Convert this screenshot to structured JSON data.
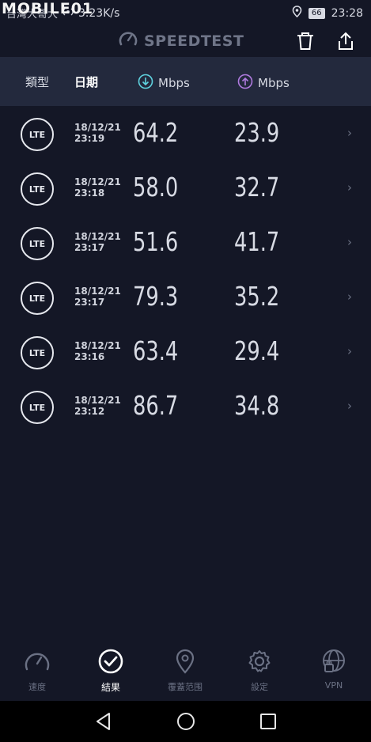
{
  "status_bar": {
    "carrier": "台灣大哥大",
    "watermark": "MOBILE01",
    "net_speed": "3.23K/s",
    "battery": "66",
    "time": "23:28"
  },
  "top_bar": {
    "title": "SPEEDTEST",
    "icons": [
      "speedometer-icon",
      "trash-icon",
      "share-icon"
    ]
  },
  "table_header": {
    "type_label": "類型",
    "date_label": "日期",
    "download_label": "Mbps",
    "upload_label": "Mbps",
    "download_icon_color": "#5fd3e0",
    "upload_icon_color": "#b07be0"
  },
  "results": [
    {
      "type": "LTE",
      "date": "18/12/21",
      "time": "23:19",
      "download": "64.2",
      "upload": "23.9"
    },
    {
      "type": "LTE",
      "date": "18/12/21",
      "time": "23:18",
      "download": "58.0",
      "upload": "32.7"
    },
    {
      "type": "LTE",
      "date": "18/12/21",
      "time": "23:17",
      "download": "51.6",
      "upload": "41.7"
    },
    {
      "type": "LTE",
      "date": "18/12/21",
      "time": "23:17",
      "download": "79.3",
      "upload": "35.2"
    },
    {
      "type": "LTE",
      "date": "18/12/21",
      "time": "23:16",
      "download": "63.4",
      "upload": "29.4"
    },
    {
      "type": "LTE",
      "date": "18/12/21",
      "time": "23:12",
      "download": "86.7",
      "upload": "34.8"
    }
  ],
  "tabs": [
    {
      "label": "速度",
      "icon": "speedometer-icon",
      "active": false
    },
    {
      "label": "結果",
      "icon": "check-circle-icon",
      "active": true
    },
    {
      "label": "覆蓋范围",
      "icon": "map-pin-icon",
      "active": false
    },
    {
      "label": "設定",
      "icon": "gear-icon",
      "active": false
    },
    {
      "label": "VPN",
      "icon": "vpn-globe-lock-icon",
      "active": false
    }
  ],
  "nav": [
    "back-icon",
    "home-icon",
    "recents-icon"
  ]
}
